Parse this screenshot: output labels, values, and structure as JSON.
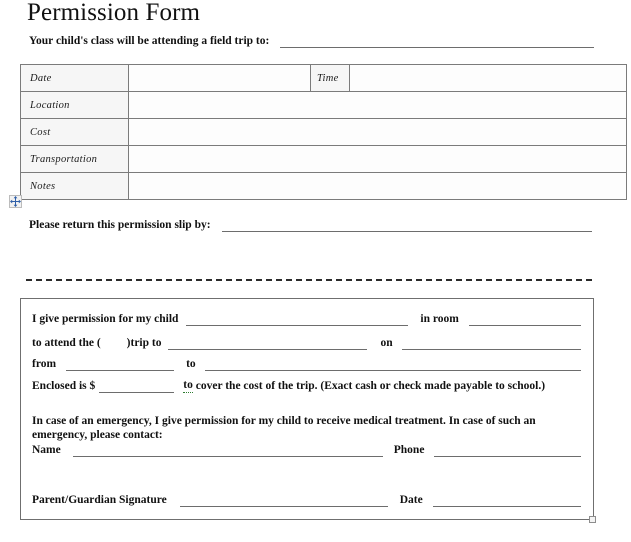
{
  "document": {
    "title": "Permission Form",
    "intro_label": "Your child's class will be attending a field trip to:",
    "return_label": "Please return this permission slip by:"
  },
  "details_table": {
    "rows": [
      {
        "label": "Date",
        "value": "",
        "label2": "Time",
        "value2": ""
      },
      {
        "label": "Location",
        "value": ""
      },
      {
        "label": "Cost",
        "value": ""
      },
      {
        "label": "Transportation",
        "value": ""
      },
      {
        "label": "Notes",
        "value": ""
      }
    ],
    "labels": {
      "date": "Date",
      "time": "Time",
      "location": "Location",
      "cost": "Cost",
      "transportation": "Transportation",
      "notes": "Notes"
    }
  },
  "table_handle": {
    "icon": "move-four-arrows-icon"
  },
  "permission_slip": {
    "line1": {
      "a": "I give permission for my child",
      "b": "in room",
      "child_value": "",
      "room_value": ""
    },
    "line2": {
      "a": "to attend the (",
      "b": ")trip to",
      "c": "on",
      "trip_value": "",
      "date_value": ""
    },
    "line3": {
      "a": "from",
      "b": "to",
      "from_value": "",
      "to_value": ""
    },
    "line4": {
      "a": "Enclosed is $",
      "amount_value": "",
      "b_gram": "to",
      "c": " cover the cost of the trip. (Exact cash or check made payable to school.)"
    },
    "emergency_paragraph": "In case of an emergency, I give permission for my child to receive medical treatment. In case of such an emergency, please contact:",
    "name_label": "Name",
    "name_value": "",
    "phone_label": "Phone",
    "phone_value": "",
    "signature_label": "Parent/Guardian Signature",
    "signature_value": "",
    "date_label": "Date",
    "date_value": ""
  },
  "colors": {
    "rule": "#6d6d6d",
    "table_border": "#7b7b7b",
    "label_fill": "#f6f6f6",
    "cut_line": "#2b2b2b",
    "grammar_underline": "#2f7d32",
    "handle_accent": "#2f5fa8"
  }
}
